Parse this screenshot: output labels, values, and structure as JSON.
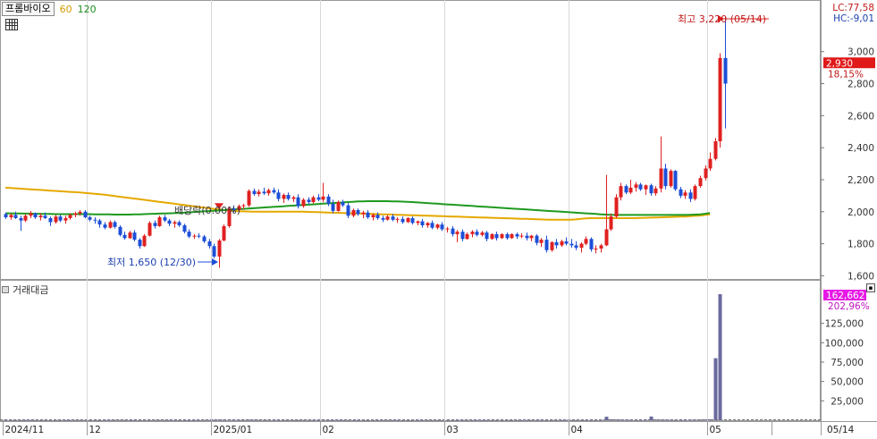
{
  "header": {
    "stock_name": "프롬바이오",
    "ma60_label": "60",
    "ma120_label": "120"
  },
  "right_info": {
    "lc": "LC:77,58",
    "hc": "HC:-9,01",
    "price_badge": "2,930",
    "price_pct": "18,15%",
    "vol_badge": "162,662",
    "vol_pct": "202,96%"
  },
  "annotations": {
    "high": "최고 3,220 (05/14)",
    "low": "최저 1,650 (12/30)",
    "dividend": "배당락(0.00%)"
  },
  "volume_header": {
    "title": "거래대금"
  },
  "colors": {
    "up": "#e02020",
    "down": "#1c4fd8",
    "ma60": "#e5a800",
    "ma120": "#1f9a1f",
    "volume": "#6a6a9c",
    "price_badge": "#e01919",
    "vol_badge": "#e619e6"
  },
  "chart_data": {
    "type": "candlestick",
    "price_axis": {
      "ylim": [
        1580,
        3300
      ],
      "ticks": [
        1600,
        1800,
        2000,
        2200,
        2400,
        2600,
        2800,
        3000
      ],
      "tick_labels": [
        "1,600",
        "1,800",
        "2,000",
        "2,200",
        "2,400",
        "2,600",
        "2,800",
        "3,000"
      ]
    },
    "volume_axis": {
      "ylim": [
        0,
        165000
      ],
      "ticks": [
        25000,
        50000,
        75000,
        100000,
        125000
      ],
      "tick_labels": [
        "25,000",
        "50,000",
        "75,000",
        "100,000",
        "125,000"
      ]
    },
    "x_axis_labels": [
      {
        "index": 0,
        "label": "2024/11"
      },
      {
        "index": 17,
        "label": "12"
      },
      {
        "index": 42,
        "label": "2025/01"
      },
      {
        "index": 64,
        "label": "02"
      },
      {
        "index": 89,
        "label": "03"
      },
      {
        "index": 114,
        "label": "04"
      },
      {
        "index": 142,
        "label": "05"
      },
      {
        "index": 155,
        "label": "05/14"
      }
    ],
    "ohlc": [
      [
        1985,
        1995,
        1955,
        1965
      ],
      [
        1965,
        1990,
        1950,
        1980
      ],
      [
        1980,
        2000,
        1955,
        1960
      ],
      [
        1960,
        1975,
        1880,
        1945
      ],
      [
        1945,
        1985,
        1935,
        1975
      ],
      [
        1975,
        2005,
        1960,
        1990
      ],
      [
        1990,
        1995,
        1955,
        1965
      ],
      [
        1965,
        1990,
        1945,
        1975
      ],
      [
        1975,
        1995,
        1955,
        1960
      ],
      [
        1960,
        1970,
        1910,
        1935
      ],
      [
        1935,
        1980,
        1925,
        1970
      ],
      [
        1970,
        1980,
        1935,
        1945
      ],
      [
        1945,
        1975,
        1925,
        1960
      ],
      [
        1960,
        1990,
        1950,
        1980
      ],
      [
        1980,
        2000,
        1965,
        1990
      ],
      [
        1990,
        2010,
        1975,
        2000
      ],
      [
        2000,
        2010,
        1960,
        1965
      ],
      [
        1965,
        1975,
        1940,
        1950
      ],
      [
        1950,
        1965,
        1925,
        1945
      ],
      [
        1945,
        1955,
        1900,
        1920
      ],
      [
        1920,
        1935,
        1890,
        1900
      ],
      [
        1900,
        1945,
        1895,
        1935
      ],
      [
        1935,
        1945,
        1895,
        1905
      ],
      [
        1905,
        1915,
        1845,
        1855
      ],
      [
        1855,
        1875,
        1825,
        1835
      ],
      [
        1835,
        1880,
        1830,
        1870
      ],
      [
        1870,
        1885,
        1815,
        1825
      ],
      [
        1825,
        1835,
        1770,
        1785
      ],
      [
        1785,
        1860,
        1780,
        1850
      ],
      [
        1850,
        1940,
        1845,
        1930
      ],
      [
        1930,
        1945,
        1895,
        1910
      ],
      [
        1910,
        1975,
        1905,
        1965
      ],
      [
        1965,
        1980,
        1935,
        1945
      ],
      [
        1945,
        1955,
        1910,
        1925
      ],
      [
        1925,
        1945,
        1900,
        1935
      ],
      [
        1935,
        1945,
        1905,
        1915
      ],
      [
        1915,
        1925,
        1865,
        1875
      ],
      [
        1875,
        1890,
        1835,
        1845
      ],
      [
        1845,
        1860,
        1830,
        1850
      ],
      [
        1850,
        1865,
        1835,
        1845
      ],
      [
        1845,
        1855,
        1805,
        1815
      ],
      [
        1815,
        1830,
        1770,
        1785
      ],
      [
        1785,
        1800,
        1710,
        1720
      ],
      [
        1720,
        1830,
        1650,
        1820
      ],
      [
        1820,
        1920,
        1815,
        1910
      ],
      [
        1910,
        2030,
        1900,
        2020
      ],
      [
        2020,
        2040,
        1995,
        2010
      ],
      [
        2010,
        2045,
        2000,
        2035
      ],
      [
        2035,
        2050,
        2015,
        2040
      ],
      [
        2040,
        2140,
        2030,
        2130
      ],
      [
        2130,
        2145,
        2100,
        2110
      ],
      [
        2110,
        2140,
        2095,
        2125
      ],
      [
        2125,
        2150,
        2105,
        2115
      ],
      [
        2115,
        2145,
        2100,
        2135
      ],
      [
        2135,
        2150,
        2110,
        2120
      ],
      [
        2120,
        2140,
        2065,
        2080
      ],
      [
        2080,
        2115,
        2055,
        2105
      ],
      [
        2105,
        2120,
        2070,
        2080
      ],
      [
        2080,
        2100,
        2060,
        2090
      ],
      [
        2090,
        2110,
        2020,
        2035
      ],
      [
        2035,
        2085,
        2025,
        2075
      ],
      [
        2075,
        2090,
        2045,
        2060
      ],
      [
        2060,
        2100,
        2050,
        2090
      ],
      [
        2090,
        2110,
        2065,
        2075
      ],
      [
        2075,
        2180,
        2060,
        2095
      ],
      [
        2095,
        2110,
        2035,
        2050
      ],
      [
        2050,
        2075,
        1990,
        2005
      ],
      [
        2005,
        2070,
        2000,
        2060
      ],
      [
        2060,
        2075,
        2030,
        2040
      ],
      [
        2040,
        2055,
        1960,
        1975
      ],
      [
        1975,
        2020,
        1965,
        2010
      ],
      [
        2010,
        2020,
        1975,
        1985
      ],
      [
        1985,
        2005,
        1960,
        1995
      ],
      [
        1995,
        2010,
        1955,
        1965
      ],
      [
        1965,
        1990,
        1945,
        1980
      ],
      [
        1980,
        1995,
        1950,
        1960
      ],
      [
        1960,
        1975,
        1935,
        1950
      ],
      [
        1950,
        1980,
        1945,
        1970
      ],
      [
        1970,
        1985,
        1940,
        1950
      ],
      [
        1950,
        1965,
        1930,
        1955
      ],
      [
        1955,
        1970,
        1925,
        1935
      ],
      [
        1935,
        1965,
        1930,
        1960
      ],
      [
        1960,
        1970,
        1920,
        1930
      ],
      [
        1930,
        1945,
        1915,
        1940
      ],
      [
        1940,
        1955,
        1900,
        1915
      ],
      [
        1915,
        1935,
        1900,
        1930
      ],
      [
        1930,
        1945,
        1890,
        1900
      ],
      [
        1900,
        1925,
        1890,
        1920
      ],
      [
        1920,
        1935,
        1880,
        1890
      ],
      [
        1890,
        1905,
        1870,
        1895
      ],
      [
        1895,
        1910,
        1845,
        1860
      ],
      [
        1860,
        1885,
        1810,
        1875
      ],
      [
        1875,
        1890,
        1815,
        1830
      ],
      [
        1830,
        1870,
        1825,
        1860
      ],
      [
        1860,
        1885,
        1840,
        1875
      ],
      [
        1875,
        1890,
        1845,
        1855
      ],
      [
        1855,
        1880,
        1845,
        1870
      ],
      [
        1870,
        1880,
        1815,
        1830
      ],
      [
        1830,
        1865,
        1825,
        1860
      ],
      [
        1860,
        1875,
        1820,
        1835
      ],
      [
        1835,
        1865,
        1830,
        1860
      ],
      [
        1860,
        1870,
        1825,
        1835
      ],
      [
        1835,
        1865,
        1830,
        1860
      ],
      [
        1860,
        1870,
        1830,
        1845
      ],
      [
        1845,
        1865,
        1835,
        1850
      ],
      [
        1850,
        1870,
        1820,
        1835
      ],
      [
        1835,
        1855,
        1815,
        1850
      ],
      [
        1850,
        1860,
        1790,
        1805
      ],
      [
        1805,
        1835,
        1780,
        1825
      ],
      [
        1825,
        1850,
        1745,
        1760
      ],
      [
        1760,
        1815,
        1750,
        1810
      ],
      [
        1810,
        1830,
        1770,
        1790
      ],
      [
        1790,
        1825,
        1780,
        1815
      ],
      [
        1815,
        1840,
        1790,
        1800
      ],
      [
        1800,
        1830,
        1775,
        1790
      ],
      [
        1790,
        1815,
        1760,
        1775
      ],
      [
        1775,
        1810,
        1745,
        1800
      ],
      [
        1800,
        1845,
        1790,
        1830
      ],
      [
        1830,
        1840,
        1750,
        1765
      ],
      [
        1765,
        1790,
        1740,
        1770
      ],
      [
        1770,
        1800,
        1745,
        1790
      ],
      [
        1790,
        2230,
        1785,
        1890
      ],
      [
        1890,
        1990,
        1880,
        1970
      ],
      [
        1970,
        2110,
        1960,
        2090
      ],
      [
        2090,
        2180,
        2070,
        2160
      ],
      [
        2160,
        2170,
        2110,
        2120
      ],
      [
        2120,
        2200,
        2110,
        2150
      ],
      [
        2150,
        2185,
        2125,
        2170
      ],
      [
        2170,
        2180,
        2130,
        2140
      ],
      [
        2140,
        2170,
        2105,
        2165
      ],
      [
        2165,
        2175,
        2100,
        2115
      ],
      [
        2115,
        2160,
        2100,
        2145
      ],
      [
        2145,
        2470,
        2120,
        2270
      ],
      [
        2270,
        2300,
        2140,
        2160
      ],
      [
        2160,
        2265,
        2150,
        2255
      ],
      [
        2255,
        2260,
        2130,
        2140
      ],
      [
        2140,
        2155,
        2085,
        2100
      ],
      [
        2100,
        2135,
        2080,
        2120
      ],
      [
        2120,
        2140,
        2060,
        2080
      ],
      [
        2080,
        2170,
        2070,
        2160
      ],
      [
        2160,
        2225,
        2150,
        2210
      ],
      [
        2210,
        2290,
        2195,
        2270
      ],
      [
        2270,
        2370,
        2255,
        2330
      ],
      [
        2330,
        2460,
        2320,
        2440
      ],
      [
        2440,
        2990,
        2400,
        2960
      ],
      [
        2960,
        3220,
        2520,
        2800
      ]
    ],
    "ma60": [
      2150,
      2148,
      2146,
      2144,
      2142,
      2140,
      2138,
      2136,
      2134,
      2132,
      2130,
      2128,
      2126,
      2124,
      2122,
      2120,
      2118,
      2115,
      2112,
      2109,
      2106,
      2102,
      2098,
      2094,
      2090,
      2086,
      2082,
      2078,
      2074,
      2070,
      2066,
      2062,
      2058,
      2054,
      2050,
      2046,
      2042,
      2038,
      2034,
      2030,
      2026,
      2022,
      2018,
      2014,
      2010,
      2007,
      2005,
      2003,
      2002,
      2001,
      2000,
      2000,
      2000,
      2000,
      2000,
      2000,
      2000,
      2000,
      2000,
      2000,
      2000,
      1999,
      1998,
      1997,
      1996,
      1995,
      1994,
      1993,
      1992,
      1991,
      1990,
      1989,
      1988,
      1987,
      1986,
      1985,
      1984,
      1983,
      1982,
      1981,
      1980,
      1979,
      1978,
      1977,
      1976,
      1975,
      1974,
      1973,
      1972,
      1971,
      1970,
      1969,
      1968,
      1967,
      1966,
      1965,
      1964,
      1963,
      1962,
      1961,
      1960,
      1959,
      1958,
      1957,
      1956,
      1955,
      1954,
      1953,
      1952,
      1951,
      1950,
      1950,
      1950,
      1950,
      1950,
      1952,
      1955,
      1958,
      1960,
      1960,
      1960,
      1960,
      1960,
      1960,
      1960,
      1960,
      1960,
      1960,
      1961,
      1962,
      1963,
      1964,
      1965,
      1966,
      1967,
      1968,
      1969,
      1970,
      1972,
      1974,
      1976,
      1980,
      1984
    ],
    "ma120": [
      1990,
      1990,
      1989,
      1989,
      1988,
      1988,
      1987,
      1987,
      1986,
      1986,
      1985,
      1985,
      1985,
      1985,
      1985,
      1985,
      1985,
      1985,
      1984,
      1984,
      1983,
      1983,
      1982,
      1982,
      1982,
      1982,
      1983,
      1984,
      1985,
      1986,
      1987,
      1988,
      1989,
      1990,
      1991,
      1992,
      1994,
      1996,
      1998,
      2000,
      2002,
      2004,
      2006,
      2008,
      2010,
      2012,
      2014,
      2016,
      2018,
      2020,
      2022,
      2024,
      2026,
      2028,
      2030,
      2032,
      2034,
      2036,
      2038,
      2040,
      2042,
      2044,
      2046,
      2048,
      2050,
      2052,
      2054,
      2056,
      2058,
      2060,
      2062,
      2064,
      2065,
      2066,
      2066,
      2066,
      2066,
      2066,
      2065,
      2064,
      2063,
      2062,
      2060,
      2058,
      2056,
      2054,
      2052,
      2050,
      2048,
      2046,
      2044,
      2042,
      2040,
      2038,
      2036,
      2034,
      2032,
      2030,
      2028,
      2026,
      2024,
      2022,
      2020,
      2018,
      2016,
      2014,
      2012,
      2010,
      2008,
      2006,
      2004,
      2002,
      2000,
      1998,
      1996,
      1994,
      1992,
      1990,
      1988,
      1986,
      1984,
      1982,
      1981,
      1980,
      1980,
      1980,
      1980,
      1980,
      1980,
      1980,
      1980,
      1980,
      1980,
      1980,
      1980,
      1980,
      1980,
      1980,
      1981,
      1982,
      1984,
      1987,
      1992
    ],
    "volume": [
      400,
      300,
      350,
      280,
      320,
      300,
      260,
      240,
      260,
      280,
      300,
      320,
      280,
      260,
      300,
      340,
      320,
      300,
      280,
      260,
      300,
      320,
      340,
      300,
      260,
      280,
      300,
      360,
      420,
      380,
      340,
      300,
      260,
      280,
      300,
      260,
      240,
      220,
      240,
      260,
      300,
      340,
      600,
      900,
      700,
      800,
      600,
      500,
      450,
      700,
      500,
      450,
      400,
      380,
      360,
      340,
      320,
      300,
      300,
      320,
      340,
      300,
      280,
      300,
      600,
      400,
      350,
      300,
      280,
      260,
      240,
      260,
      280,
      300,
      260,
      240,
      260,
      280,
      300,
      260,
      240,
      220,
      240,
      260,
      280,
      260,
      240,
      220,
      240,
      260,
      280,
      300,
      320,
      300,
      280,
      260,
      240,
      260,
      280,
      300,
      260,
      240,
      220,
      240,
      260,
      280,
      300,
      320,
      340,
      300,
      280,
      260,
      280,
      300,
      260,
      240,
      260,
      280,
      300,
      320,
      400,
      4500,
      1200,
      900,
      800,
      700,
      600,
      500,
      400,
      600,
      4800,
      900,
      700,
      600,
      500,
      400,
      500,
      600,
      700,
      800,
      900,
      1000,
      1200,
      80000,
      162662
    ]
  }
}
